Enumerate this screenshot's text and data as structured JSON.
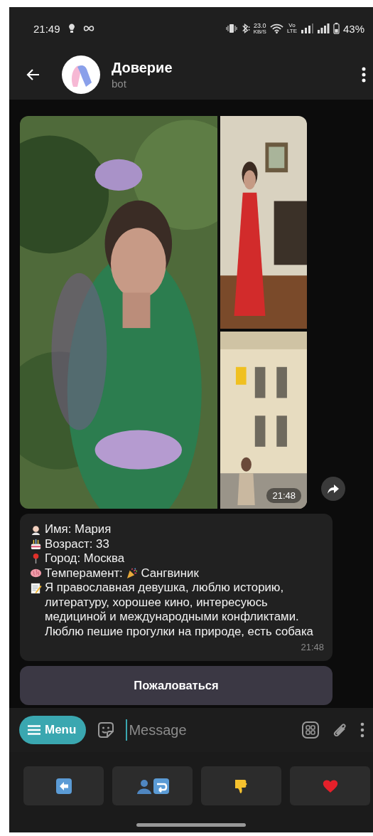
{
  "status_bar": {
    "time": "21:49",
    "net_speed": "23.0",
    "net_unit": "KB/S",
    "volte_top": "Vo",
    "volte_bottom": "LTE",
    "battery": "43%"
  },
  "header": {
    "title": "Доверие",
    "subtitle": "bot"
  },
  "album": {
    "time": "21:48"
  },
  "message": {
    "lines": [
      {
        "text": "Имя: Мария"
      },
      {
        "text": "Возраст: 33"
      },
      {
        "text": "Город: Москва"
      },
      {
        "text": "Темперамент:",
        "value": "Сангвиник"
      },
      {
        "text": "Я православная девушка, люблю историю, литературу, хорошее кино, интересуюсь медициной и международными конфликтами. Люблю пешие прогулки на природе, есть собака"
      }
    ],
    "time": "21:48"
  },
  "inline_button": "Пожаловаться",
  "composer": {
    "menu": "Menu",
    "placeholder": "Message"
  },
  "keyboard": [
    {
      "kind": "back"
    },
    {
      "kind": "swap"
    },
    {
      "kind": "dislike"
    },
    {
      "kind": "like"
    }
  ]
}
